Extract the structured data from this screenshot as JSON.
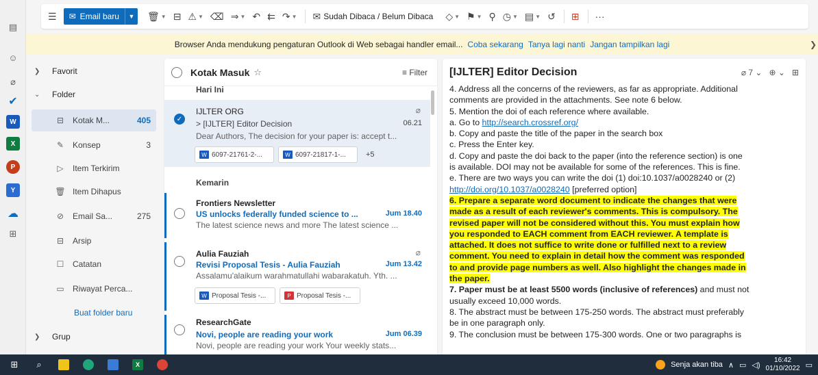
{
  "rail": {
    "icons": [
      "calendar-icon",
      "people-icon",
      "attach-icon",
      "todo-icon",
      "word-icon",
      "excel-icon",
      "powerpoint-icon",
      "yammer-icon",
      "onedrive-icon",
      "apps-icon"
    ],
    "tiles": {
      "word": "W",
      "excel": "X",
      "powerpoint": "P",
      "yammer": "Y"
    }
  },
  "toolbar": {
    "new_mail_label": "Email baru",
    "read_unread_label": "Sudah Dibaca / Belum Dibaca",
    "more": "···"
  },
  "banner": {
    "message": "Browser Anda mendukung pengaturan Outlook di Web sebagai handler email...",
    "links": [
      "Coba sekarang",
      "Tanya lagi nanti",
      "Jangan tampilkan lagi"
    ]
  },
  "folders": {
    "favorites": "Favorit",
    "folder_group": "Folder",
    "items": [
      {
        "label": "Kotak M...",
        "count": "405"
      },
      {
        "label": "Konsep",
        "count": "3"
      },
      {
        "label": "Item Terkirim",
        "count": ""
      },
      {
        "label": "Item Dihapus",
        "count": ""
      },
      {
        "label": "Email Sa...",
        "count": "275"
      },
      {
        "label": "Arsip",
        "count": ""
      },
      {
        "label": "Catatan",
        "count": ""
      },
      {
        "label": "Riwayat Perca...",
        "count": ""
      }
    ],
    "new_folder": "Buat folder baru",
    "groups": "Grup"
  },
  "list": {
    "title": "Kotak Masuk",
    "filter": "Filter",
    "today": "Hari Ini",
    "yesterday": "Kemarin",
    "messages": [
      {
        "sender": "IJLTER ORG",
        "subject": "> [IJLTER] Editor Decision",
        "time": "06.21",
        "preview": "Dear Authors, The decision for your paper is: accept t...",
        "attachments": [
          "6097-21761-2-...",
          "6097-21817-1-..."
        ],
        "more": "+5"
      },
      {
        "sender": "Frontiers Newsletter",
        "subject": "US unlocks federally funded science to ...",
        "time": "Jum 18.40",
        "preview": "The latest science news and more The latest science ..."
      },
      {
        "sender": "Aulia Fauziah",
        "subject": "Revisi Proposal Tesis - Aulia Fauziah",
        "time": "Jum 13.42",
        "preview": "Assalamu'alaikum warahmatullahi wabarakatuh. Yth. ...",
        "attachments": [
          "Proposal Tesis -...",
          "Proposal Tesis -..."
        ]
      },
      {
        "sender": "ResearchGate",
        "subject": "Novi, people are reading your work",
        "time": "Jum 06.39",
        "preview": "Novi, people are reading your work Your weekly stats..."
      }
    ]
  },
  "reading": {
    "title": "[IJLTER] Editor Decision",
    "attach_count": "7",
    "lines": {
      "l1": "4. Address all the concerns of the reviewers, as far as appropriate. Additional",
      "l2": "comments are provided in the attachments. See note 6 below.",
      "l3": "5. Mention the doi of each reference where available.",
      "l4a": "a. Go to ",
      "l4link": "http://search.crossref.org/",
      "l5": "b. Copy and paste the title of the paper in the search box",
      "l6": "c. Press the Enter key.",
      "l7": "d. Copy and paste the doi back to the paper (into the reference section) is one",
      "l8": "is available. DOI may not be available for some of the references. This is fine.",
      "l9": "e. There are two ways you can write the doi (1) doi:10.1037/a0028240 or (2)",
      "l10link": "http://doi.org/10.1037/a0028240",
      "l10b": " [preferred option]",
      "h1": "6. Prepare a separate word document to indicate the changes that were",
      "h2": "made as a result of each reviewer's comments. This is compulsory. The",
      "h3": "revised paper will not be considered without this. You must explain how",
      "h4": "you responded to EACH comment from EACH reviewer. A template is",
      "h5": "attached. It does not suffice to write done or fulfilled next to a review",
      "h6": "comment. You need to explain in detail how the comment was responded",
      "h7": "to and provide page numbers as well. Also highlight the changes made in",
      "h8": "the paper.",
      "l11b": "7. Paper must be at least 5500 words (inclusive of references)",
      "l11": " and must not",
      "l12": "usually exceed 10,000 words.",
      "l13": "8. The abstract must be between 175-250 words. The abstract must preferably",
      "l14": "be in one paragraph only.",
      "l15": "9. The conclusion must be between 175-300 words. One or two paragraphs is"
    }
  },
  "taskbar": {
    "weather": "Senja akan tiba",
    "time": "16:42",
    "date": "01/10/2022"
  },
  "colors": {
    "accent": "#0f6cbd",
    "banner": "#fcf6d4",
    "highlight": "#ffff00",
    "taskbar": "#1f2d3d"
  }
}
